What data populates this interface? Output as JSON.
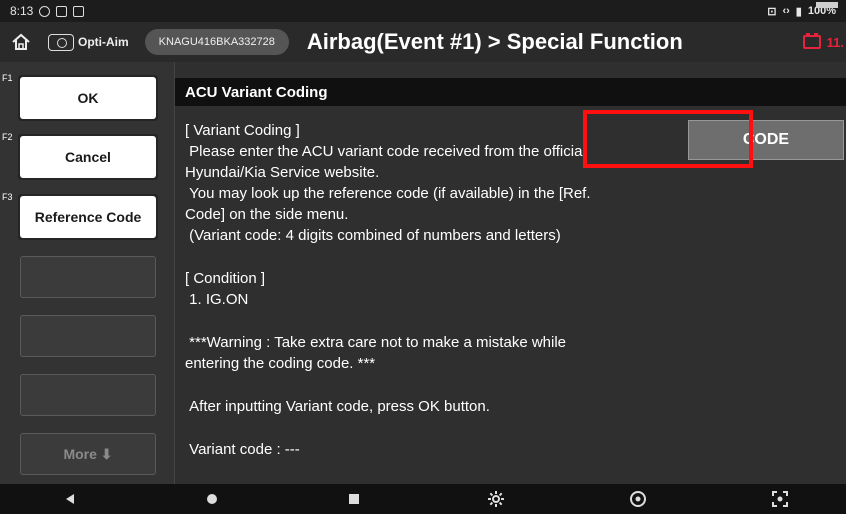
{
  "status_bar": {
    "time": "8:13",
    "right_text": "100%"
  },
  "header": {
    "opti_aim_label": "Opti-Aim",
    "vin": "KNAGU416BKA332728",
    "title": "Airbag(Event #1) > Special Function",
    "battery_value": "11."
  },
  "side_menu": {
    "buttons": [
      {
        "fkey": "F1",
        "label": "OK"
      },
      {
        "fkey": "F2",
        "label": "Cancel"
      },
      {
        "fkey": "F3",
        "label": "Reference Code"
      },
      {
        "fkey": "",
        "label": ""
      },
      {
        "fkey": "",
        "label": ""
      },
      {
        "fkey": "",
        "label": ""
      },
      {
        "fkey": "",
        "label": "More ⬇"
      }
    ]
  },
  "panel": {
    "title": "ACU Variant Coding",
    "code_button_label": "CODE",
    "paragraphs": [
      "[ Variant Coding ]\n Please enter the ACU variant code received from the official\nHyundai/Kia Service website.\n You may look up the reference code (if available) in the [Ref.\nCode] on the side menu.\n (Variant code: 4 digits combined of numbers and letters)",
      "[ Condition ]\n 1. IG.ON",
      " ***Warning : Take extra care not to make a mistake while\nentering the coding code. ***",
      " After inputting Variant code, press OK button.",
      " Variant code : ---"
    ]
  },
  "nav_bar": {
    "icons": [
      "back-icon",
      "home-icon",
      "recents-icon",
      "settings-icon",
      "browser-icon",
      "screenshot-icon"
    ]
  },
  "colors": {
    "highlight": "#ff1010",
    "battery_warning": "#e5233d"
  }
}
